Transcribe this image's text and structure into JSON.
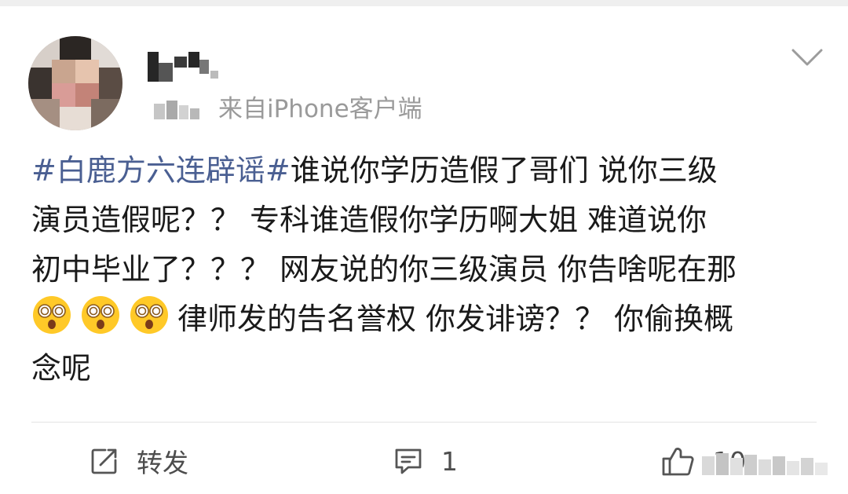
{
  "post": {
    "hashtag": "#白鹿方六连辟谣#",
    "line1_rest": "谁说你学历造假了哥们 说你三级",
    "line2": "演员造假呢？？ 专科谁造假你学历啊大姐 难道说你",
    "line3": "初中毕业了？？？ 网友说的你三级演员 你告啥呢在那",
    "line4_rest": "律师发的告名誉权 你发诽谤？？ 你偷换概",
    "line5": "念呢",
    "emoji_icon": "dizzy-face-emoji",
    "emoji_count": 3
  },
  "header": {
    "source": "来自iPhone客户端"
  },
  "actions": {
    "repost_label": "转发",
    "comment_count": "1",
    "like_count": "10"
  },
  "colors": {
    "hashtag": "#4a5f92",
    "text": "#1a1a1a",
    "meta": "#9a9a9a"
  }
}
